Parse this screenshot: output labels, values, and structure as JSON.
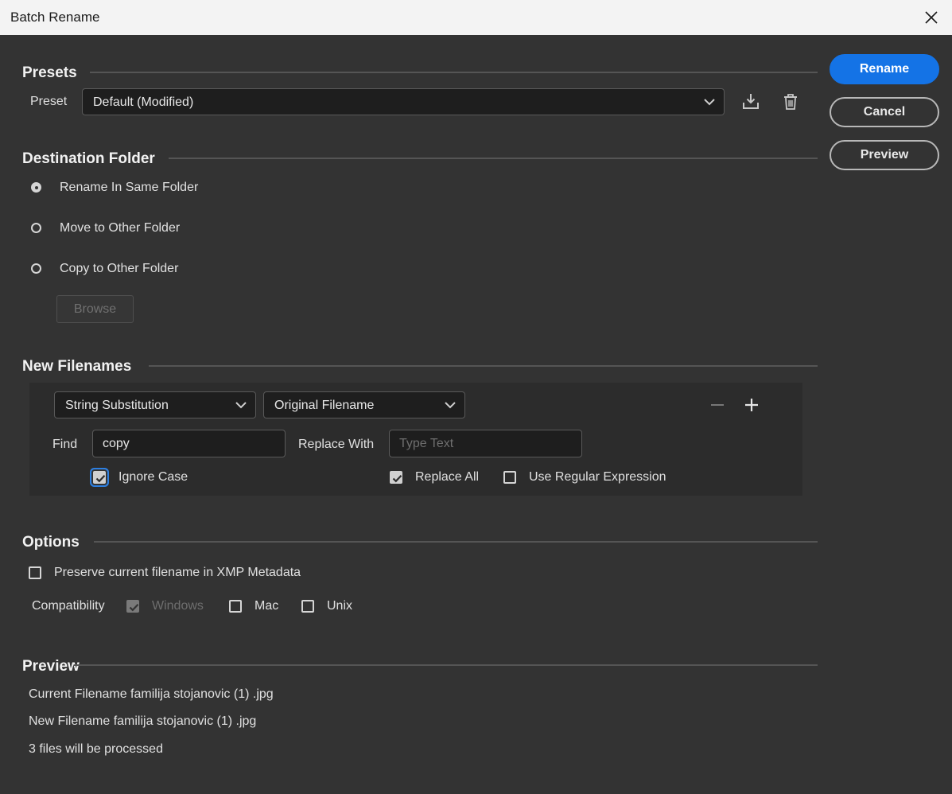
{
  "window": {
    "title": "Batch Rename"
  },
  "presets": {
    "section_title": "Presets",
    "preset_label": "Preset",
    "preset_value": "Default (Modified)"
  },
  "actions": {
    "rename": "Rename",
    "cancel": "Cancel",
    "preview": "Preview"
  },
  "destination": {
    "section_title": "Destination Folder",
    "options": [
      "Rename In Same Folder",
      "Move to Other Folder",
      "Copy to Other Folder"
    ],
    "selected": "Rename In Same Folder",
    "browse_label": "Browse"
  },
  "new_filenames": {
    "section_title": "New Filenames",
    "type_value": "String Substitution",
    "source_value": "Original Filename",
    "find_label": "Find",
    "find_value": "copy",
    "replace_label": "Replace With",
    "replace_placeholder": "Type Text",
    "ignore_case_label": "Ignore Case",
    "ignore_case_checked": true,
    "replace_all_label": "Replace All",
    "replace_all_checked": true,
    "use_regex_label": "Use Regular Expression",
    "use_regex_checked": false
  },
  "options": {
    "section_title": "Options",
    "preserve_label": "Preserve current filename in XMP Metadata",
    "preserve_checked": false,
    "compat_label": "Compatibility",
    "windows_label": "Windows",
    "windows_checked": true,
    "mac_label": "Mac",
    "mac_checked": false,
    "unix_label": "Unix",
    "unix_checked": false
  },
  "preview": {
    "section_title": "Preview",
    "current": "Current Filename familija stojanovic  (1) .jpg",
    "new": "New Filename familija stojanovic  (1) .jpg",
    "count": "3 files will be processed"
  },
  "colors": {
    "accent": "#1473e6",
    "background": "#333333",
    "titlebar": "#f3f3f3"
  },
  "icons": [
    "close-icon",
    "save-preset-icon",
    "trash-icon",
    "chevron-down-icon",
    "minus-icon",
    "plus-icon",
    "checkmark-icon"
  ]
}
